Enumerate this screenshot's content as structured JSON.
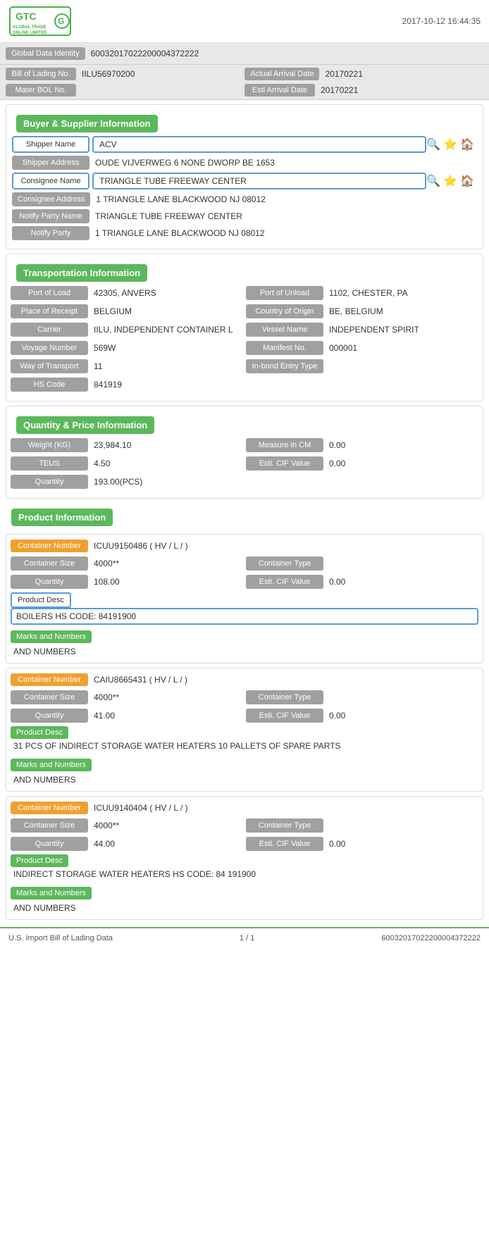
{
  "header": {
    "timestamp": "2017-10-12  16:44:35",
    "logo_text": "GTC",
    "logo_sub": "GLOBAL TRADE ONLINE LIMITED"
  },
  "global_identity": {
    "label": "Global Data Identity",
    "value": "60032017022200004372222"
  },
  "top_fields": {
    "bill_label": "Bill of Lading No.",
    "bill_value": "IILU56970200",
    "arrival_label": "Actual Arrival Date",
    "arrival_value": "20170221",
    "mater_label": "Mater BOL No.",
    "mater_value": "",
    "esti_label": "Esti Arrival Date",
    "esti_value": "20170221"
  },
  "buyer_supplier": {
    "section_title": "Buyer & Supplier Information",
    "shipper_name_label": "Shipper Name",
    "shipper_name_value": "ACV",
    "shipper_addr_label": "Shipper Address",
    "shipper_addr_value": "OUDE VIJVERWEG 6 NONE DWORP BE 1653",
    "consignee_name_label": "Consignee Name",
    "consignee_name_value": "TRIANGLE TUBE FREEWAY CENTER",
    "consignee_addr_label": "Consignee Address",
    "consignee_addr_value": "1 TRIANGLE LANE BLACKWOOD NJ 08012",
    "notify_name_label": "Notify Party Name",
    "notify_name_value": "TRIANGLE TUBE FREEWAY CENTER",
    "notify_party_label": "Notify Party",
    "notify_party_value": "1 TRIANGLE LANE BLACKWOOD NJ 08012"
  },
  "transportation": {
    "section_title": "Transportation Information",
    "port_load_label": "Port of Load",
    "port_load_value": "42305, ANVERS",
    "port_unload_label": "Port of Unload",
    "port_unload_value": "1102, CHESTER, PA",
    "place_receipt_label": "Place of Receipt",
    "place_receipt_value": "BELGIUM",
    "country_origin_label": "Country of Origin",
    "country_origin_value": "BE, BELGIUM",
    "carrier_label": "Carrier",
    "carrier_value": "IILU, INDEPENDENT CONTAINER L",
    "vessel_label": "Vessel Name",
    "vessel_value": "INDEPENDENT SPIRIT",
    "voyage_label": "Voyage Number",
    "voyage_value": "569W",
    "manifest_label": "Manifest No.",
    "manifest_value": "000001",
    "way_transport_label": "Way of Transport",
    "way_transport_value": "11",
    "inbond_label": "In-bond Entry Type",
    "inbond_value": "",
    "hs_code_label": "HS Code",
    "hs_code_value": "841919"
  },
  "quantity_price": {
    "section_title": "Quantity & Price Information",
    "weight_label": "Weight (KG)",
    "weight_value": "23,984.10",
    "measure_label": "Measure in CM",
    "measure_value": "0.00",
    "teus_label": "TEUS",
    "teus_value": "4.50",
    "esti_cif_label": "Esti. CIF Value",
    "esti_cif_value": "0.00",
    "quantity_label": "Quantity",
    "quantity_value": "193.00(PCS)"
  },
  "products": [
    {
      "container_number_label": "Container Number",
      "container_number_value": "ICUU9150486 ( HV / L / )",
      "container_size_label": "Container Size",
      "container_size_value": "4000**",
      "container_type_label": "Container Type",
      "container_type_value": "",
      "quantity_label": "Quantity",
      "quantity_value": "108.00",
      "esti_cif_label": "Esti. CIF Value",
      "esti_cif_value": "0.00",
      "product_desc_label": "Product Desc",
      "product_desc_value": "BOILERS HS CODE: 84191900",
      "product_desc_outlined": true,
      "marks_label": "Marks and Numbers",
      "marks_value": "AND NUMBERS"
    },
    {
      "container_number_label": "Container Number",
      "container_number_value": "CAIU8665431 ( HV / L / )",
      "container_size_label": "Container Size",
      "container_size_value": "4000**",
      "container_type_label": "Container Type",
      "container_type_value": "",
      "quantity_label": "Quantity",
      "quantity_value": "41.00",
      "esti_cif_label": "Esti. CIF Value",
      "esti_cif_value": "0.00",
      "product_desc_label": "Product Desc",
      "product_desc_value": "31 PCS OF INDIRECT STORAGE WATER HEATERS 10 PALLETS OF SPARE PARTS",
      "product_desc_outlined": false,
      "marks_label": "Marks and Numbers",
      "marks_value": "AND NUMBERS"
    },
    {
      "container_number_label": "Container Number",
      "container_number_value": "ICUU9140404 ( HV / L / )",
      "container_size_label": "Container Size",
      "container_size_value": "4000**",
      "container_type_label": "Container Type",
      "container_type_value": "",
      "quantity_label": "Quantity",
      "quantity_value": "44.00",
      "esti_cif_label": "Esti. CIF Value",
      "esti_cif_value": "0.00",
      "product_desc_label": "Product Desc",
      "product_desc_value": "INDIRECT STORAGE WATER HEATERS HS CODE: 84 191900",
      "product_desc_outlined": false,
      "marks_label": "Marks and Numbers",
      "marks_value": "AND NUMBERS"
    }
  ],
  "footer": {
    "left": "U.S. Import Bill of Lading Data",
    "page": "1 / 1",
    "id": "60032017022200004372222"
  },
  "icons": {
    "search": "🔍",
    "star": "⭐",
    "home": "🏠"
  }
}
